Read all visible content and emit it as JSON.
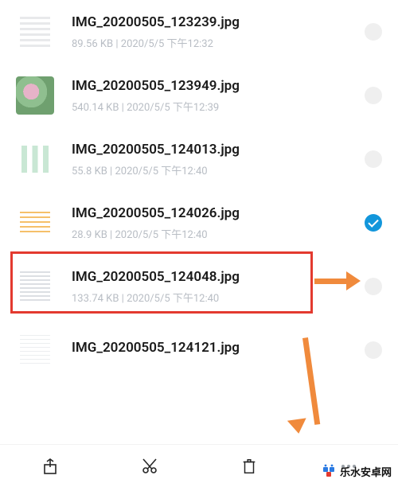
{
  "files": [
    {
      "name": "IMG_20200505_123239.jpg",
      "size": "89.56 KB",
      "date": "2020/5/5 下午12:32",
      "selected": false,
      "thumb": "th0"
    },
    {
      "name": "IMG_20200505_123949.jpg",
      "size": "540.14 KB",
      "date": "2020/5/5 下午12:39",
      "selected": false,
      "thumb": "th1"
    },
    {
      "name": "IMG_20200505_124013.jpg",
      "size": "55.8 KB",
      "date": "2020/5/5 下午12:40",
      "selected": false,
      "thumb": "th2"
    },
    {
      "name": "IMG_20200505_124026.jpg",
      "size": "28.9 KB",
      "date": "2020/5/5 下午12:40",
      "selected": true,
      "thumb": "th3"
    },
    {
      "name": "IMG_20200505_124048.jpg",
      "size": "133.74 KB",
      "date": "2020/5/5 下午12:40",
      "selected": false,
      "thumb": "th4"
    },
    {
      "name": "IMG_20200505_124121.jpg",
      "size": "",
      "date": "",
      "selected": false,
      "thumb": "th5"
    }
  ],
  "meta_separator": "  |  ",
  "toolbar": {
    "share": "share-icon",
    "cut": "scissors-icon",
    "delete": "trash-icon",
    "more": "more-icon"
  },
  "watermark": "乐水安卓网",
  "annotations": {
    "highlight_index": 3
  }
}
